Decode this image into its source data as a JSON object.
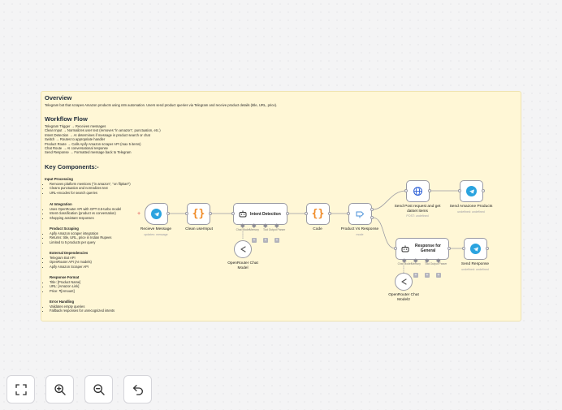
{
  "note": {
    "overview_heading": "Overview",
    "overview_text": "Telegram bot that scrapes Amazon products using n8n automation. Users send product queries via Telegram and receive product details (title, URL, price).",
    "workflow_heading": "Workflow Flow",
    "workflow_lines": [
      "Telegram Trigger → Receives messages",
      "Clean Input → Normalizes user text (removes \"in amazon\", punctuation, etc.)",
      "Intent Detection → AI determines if message is product search or chat",
      "Switch → Routes to appropriate handler",
      "Product Route → Calls Apify Amazon scraper API (max 5 items)",
      "Chat Route → AI conversational response",
      "Send Response → Formatted message back to Telegram"
    ],
    "components_heading": "Key Components:-",
    "sections": [
      {
        "title": "Input Processing",
        "items": [
          "Removes platform mentions (\"in amazon\", \"on flipkart\")",
          "Cleans punctuation and normalizes text",
          "URL-encodes for search queries"
        ]
      },
      {
        "title": "AI Integration",
        "items": [
          "Uses OpenRouter API with GPT-3.5-turbo model",
          "Intent classification (product vs conversation)",
          "Shopping assistant responses"
        ]
      },
      {
        "title": "Product Scraping",
        "items": [
          "Apify Amazon scraper integration",
          "Returns: title, URL, price in Indian Rupees",
          "Limited to 5 products per query"
        ]
      },
      {
        "title": "External Dependencies",
        "items": [
          "Telegram Bot API",
          "OpenRouter API (AI models)",
          "Apify Amazon Scraper API"
        ]
      },
      {
        "title": "Response Format",
        "items": [
          "Title: [Product Name]",
          "URL: [Amazon Link]",
          "Price: ₹[Amount]"
        ]
      },
      {
        "title": "Error Handling",
        "items": [
          "Validates empty queries",
          "Fallback responses for unrecognized intents"
        ]
      }
    ]
  },
  "nodes": {
    "receive": {
      "label": "Recieve Message",
      "sub": "updates: message"
    },
    "clean": {
      "label": "Clean userInput"
    },
    "intent": {
      "label": "Intent Detection",
      "port_labels": [
        "Chat Model",
        "Memory",
        "Tool",
        "Output Parser"
      ]
    },
    "code": {
      "label": "Code"
    },
    "switch": {
      "label": "Product Vs Response",
      "sub": "mode"
    },
    "post": {
      "label": "Send Post request and get datset items",
      "sub": "POST: undefined"
    },
    "send_products": {
      "label": "Send Amazone Products",
      "sub": "undefined: undefined"
    },
    "general": {
      "label": "Response for General",
      "port_labels": [
        "Chat Model",
        "Memory",
        "Tool",
        "Output Parser"
      ]
    },
    "send_response": {
      "label": "Send Response",
      "sub": "undefined: undefined"
    },
    "chat_model_1": {
      "label": "OpenRouter Chat Model"
    },
    "chat_model_2": {
      "label": "OpenRouter Chat Model2"
    }
  },
  "icons": {
    "trigger_color": "#2aa3df",
    "code_color": "#f08a24",
    "http_color": "#2c5fd6",
    "switch_color": "#4b92d9"
  },
  "controls": {
    "fit": "fit-view-icon",
    "zoom_in": "zoom-in-icon",
    "zoom_out": "zoom-out-icon",
    "undo": "undo-icon"
  }
}
